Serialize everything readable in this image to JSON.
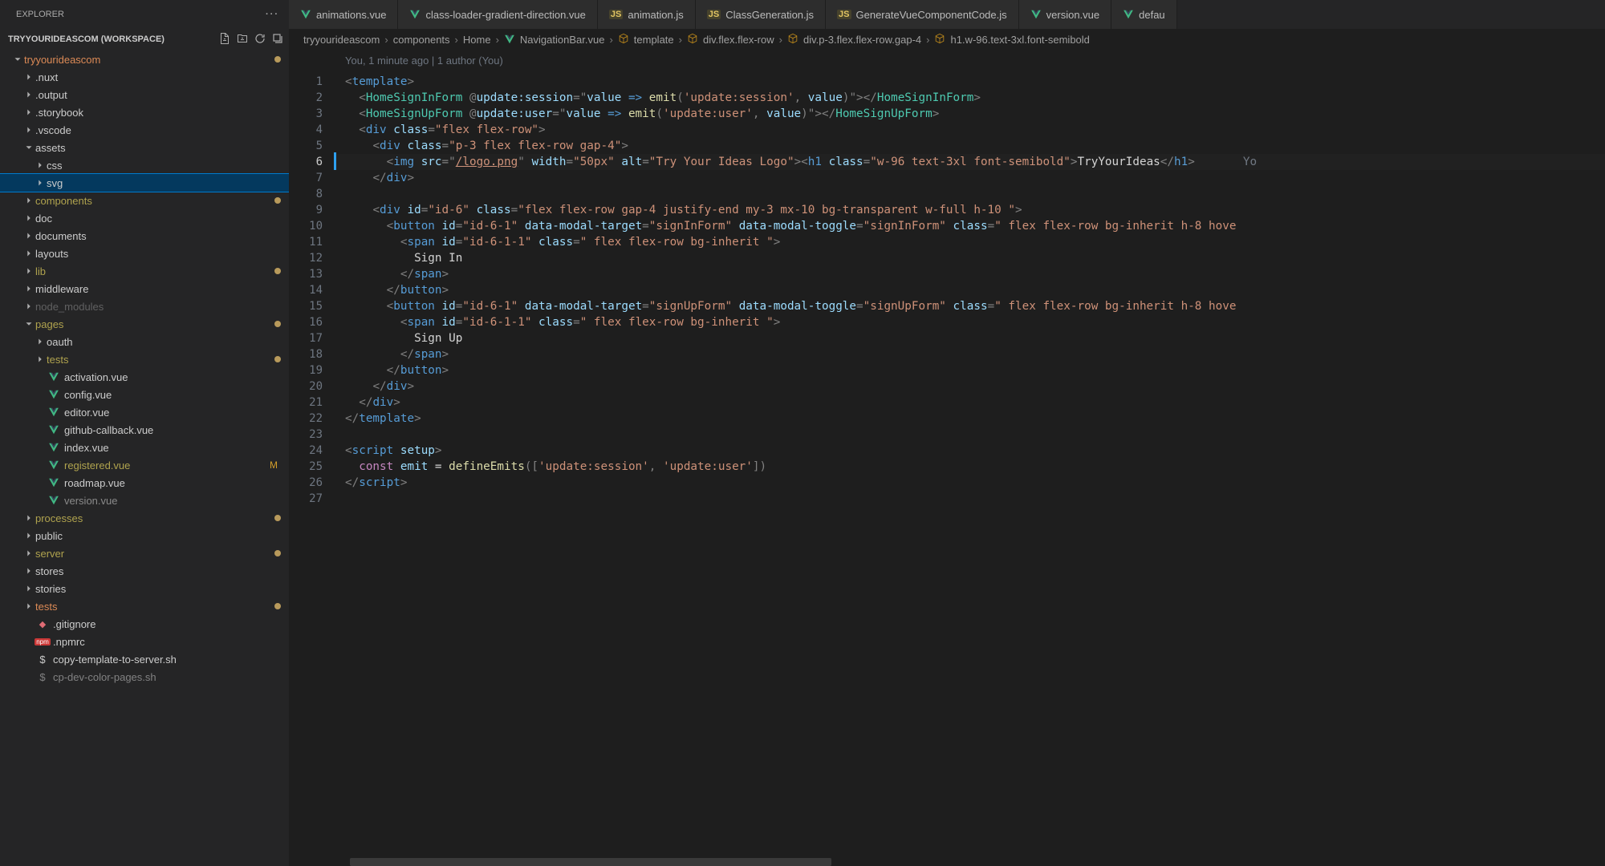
{
  "sidebar": {
    "title": "EXPLORER",
    "workspace": "TRYYOURIDEASCOM (WORKSPACE)",
    "tree": [
      {
        "label": "tryyourideascom",
        "depth": 0,
        "open": true,
        "folder": true,
        "color": "orange",
        "dot": true
      },
      {
        "label": ".nuxt",
        "depth": 1,
        "open": false,
        "folder": true,
        "color": "default"
      },
      {
        "label": ".output",
        "depth": 1,
        "open": false,
        "folder": true,
        "color": "default"
      },
      {
        "label": ".storybook",
        "depth": 1,
        "open": false,
        "folder": true,
        "color": "default"
      },
      {
        "label": ".vscode",
        "depth": 1,
        "open": false,
        "folder": true,
        "color": "default"
      },
      {
        "label": "assets",
        "depth": 1,
        "open": true,
        "folder": true,
        "color": "default"
      },
      {
        "label": "css",
        "depth": 2,
        "open": false,
        "folder": true,
        "color": "default"
      },
      {
        "label": "svg",
        "depth": 2,
        "open": false,
        "folder": true,
        "color": "default",
        "selected": true
      },
      {
        "label": "components",
        "depth": 1,
        "open": false,
        "folder": true,
        "color": "olive",
        "dot": true
      },
      {
        "label": "doc",
        "depth": 1,
        "open": false,
        "folder": true,
        "color": "default"
      },
      {
        "label": "documents",
        "depth": 1,
        "open": false,
        "folder": true,
        "color": "default"
      },
      {
        "label": "layouts",
        "depth": 1,
        "open": false,
        "folder": true,
        "color": "default"
      },
      {
        "label": "lib",
        "depth": 1,
        "open": false,
        "folder": true,
        "color": "olive",
        "dot": true
      },
      {
        "label": "middleware",
        "depth": 1,
        "open": false,
        "folder": true,
        "color": "default"
      },
      {
        "label": "node_modules",
        "depth": 1,
        "open": false,
        "folder": true,
        "color": "faded"
      },
      {
        "label": "pages",
        "depth": 1,
        "open": true,
        "folder": true,
        "color": "olive",
        "dot": true
      },
      {
        "label": "oauth",
        "depth": 2,
        "open": false,
        "folder": true,
        "color": "default"
      },
      {
        "label": "tests",
        "depth": 2,
        "open": false,
        "folder": true,
        "color": "olive",
        "dot": true
      },
      {
        "label": "activation.vue",
        "depth": 2,
        "folder": false,
        "icon": "vue",
        "color": "default"
      },
      {
        "label": "config.vue",
        "depth": 2,
        "folder": false,
        "icon": "vue",
        "color": "default"
      },
      {
        "label": "editor.vue",
        "depth": 2,
        "folder": false,
        "icon": "vue",
        "color": "default"
      },
      {
        "label": "github-callback.vue",
        "depth": 2,
        "folder": false,
        "icon": "vue",
        "color": "default"
      },
      {
        "label": "index.vue",
        "depth": 2,
        "folder": false,
        "icon": "vue",
        "color": "default"
      },
      {
        "label": "registered.vue",
        "depth": 2,
        "folder": false,
        "icon": "vue",
        "color": "olive",
        "m": "M"
      },
      {
        "label": "roadmap.vue",
        "depth": 2,
        "folder": false,
        "icon": "vue",
        "color": "default"
      },
      {
        "label": "version.vue",
        "depth": 2,
        "folder": false,
        "icon": "vue",
        "color": "dim"
      },
      {
        "label": "processes",
        "depth": 1,
        "open": false,
        "folder": true,
        "color": "olive",
        "dot": true
      },
      {
        "label": "public",
        "depth": 1,
        "open": false,
        "folder": true,
        "color": "default"
      },
      {
        "label": "server",
        "depth": 1,
        "open": false,
        "folder": true,
        "color": "olive",
        "dot": true
      },
      {
        "label": "stores",
        "depth": 1,
        "open": false,
        "folder": true,
        "color": "default"
      },
      {
        "label": "stories",
        "depth": 1,
        "open": false,
        "folder": true,
        "color": "default"
      },
      {
        "label": "tests",
        "depth": 1,
        "open": false,
        "folder": true,
        "color": "orange",
        "dot": true
      },
      {
        "label": ".gitignore",
        "depth": 1,
        "folder": false,
        "icon": "git",
        "color": "default"
      },
      {
        "label": ".npmrc",
        "depth": 1,
        "folder": false,
        "icon": "npm",
        "color": "default"
      },
      {
        "label": "copy-template-to-server.sh",
        "depth": 1,
        "folder": false,
        "icon": "sh",
        "color": "default"
      },
      {
        "label": "cp-dev-color-pages.sh",
        "depth": 1,
        "folder": false,
        "icon": "sh",
        "color": "default",
        "cut": true
      }
    ]
  },
  "tabs": [
    {
      "label": "animations.vue",
      "icon": "vue"
    },
    {
      "label": "class-loader-gradient-direction.vue",
      "icon": "vue"
    },
    {
      "label": "animation.js",
      "icon": "js"
    },
    {
      "label": "ClassGeneration.js",
      "icon": "js"
    },
    {
      "label": "GenerateVueComponentCode.js",
      "icon": "js"
    },
    {
      "label": "version.vue",
      "icon": "vue"
    },
    {
      "label": "defau",
      "icon": "vue",
      "cut": true
    }
  ],
  "breadcrumb": [
    {
      "label": "tryyourideascom"
    },
    {
      "label": "components"
    },
    {
      "label": "Home"
    },
    {
      "label": "NavigationBar.vue",
      "icon": "vue"
    },
    {
      "label": "template",
      "icon": "cube"
    },
    {
      "label": "div.flex.flex-row",
      "icon": "cube"
    },
    {
      "label": "div.p-3.flex.flex-row.gap-4",
      "icon": "cube"
    },
    {
      "label": "h1.w-96.text-3xl.font-semibold",
      "icon": "cube"
    }
  ],
  "blame": "You, 1 minute ago | 1 author (You)",
  "inline_blame": "Yo",
  "active_line": 6,
  "line_count": 27,
  "code_tokens": [
    [
      [
        "<",
        "punc"
      ],
      [
        "template",
        "tag"
      ],
      [
        ">",
        "punc"
      ]
    ],
    [
      [
        "  ",
        "plain"
      ],
      [
        "<",
        "punc"
      ],
      [
        "HomeSignInForm",
        "comp"
      ],
      [
        " @",
        "punc"
      ],
      [
        "update:session",
        "attr"
      ],
      [
        "=",
        "punc"
      ],
      [
        "\"",
        "punc"
      ],
      [
        "value",
        "var"
      ],
      [
        " ",
        "plain"
      ],
      [
        "=>",
        "arrow"
      ],
      [
        " ",
        "plain"
      ],
      [
        "emit",
        "fn"
      ],
      [
        "(",
        "punc"
      ],
      [
        "'update:session'",
        "str"
      ],
      [
        ", ",
        "punc"
      ],
      [
        "value",
        "var"
      ],
      [
        ")",
        "punc"
      ],
      [
        "\"",
        "punc"
      ],
      [
        "></",
        "punc"
      ],
      [
        "HomeSignInForm",
        "comp"
      ],
      [
        ">",
        "punc"
      ]
    ],
    [
      [
        "  ",
        "plain"
      ],
      [
        "<",
        "punc"
      ],
      [
        "HomeSignUpForm",
        "comp"
      ],
      [
        " @",
        "punc"
      ],
      [
        "update:user",
        "attr"
      ],
      [
        "=",
        "punc"
      ],
      [
        "\"",
        "punc"
      ],
      [
        "value",
        "var"
      ],
      [
        " ",
        "plain"
      ],
      [
        "=>",
        "arrow"
      ],
      [
        " ",
        "plain"
      ],
      [
        "emit",
        "fn"
      ],
      [
        "(",
        "punc"
      ],
      [
        "'update:user'",
        "str"
      ],
      [
        ", ",
        "punc"
      ],
      [
        "value",
        "var"
      ],
      [
        ")",
        "punc"
      ],
      [
        "\"",
        "punc"
      ],
      [
        "></",
        "punc"
      ],
      [
        "HomeSignUpForm",
        "comp"
      ],
      [
        ">",
        "punc"
      ]
    ],
    [
      [
        "  ",
        "plain"
      ],
      [
        "<",
        "punc"
      ],
      [
        "div",
        "tag"
      ],
      [
        " ",
        "plain"
      ],
      [
        "class",
        "attr"
      ],
      [
        "=",
        "punc"
      ],
      [
        "\"flex flex-row\"",
        "str"
      ],
      [
        ">",
        "punc"
      ]
    ],
    [
      [
        "    ",
        "plain"
      ],
      [
        "<",
        "punc"
      ],
      [
        "div",
        "tag"
      ],
      [
        " ",
        "plain"
      ],
      [
        "class",
        "attr"
      ],
      [
        "=",
        "punc"
      ],
      [
        "\"p-3 flex flex-row gap-4\"",
        "str"
      ],
      [
        ">",
        "punc"
      ]
    ],
    [
      [
        "      ",
        "plain"
      ],
      [
        "<",
        "punc"
      ],
      [
        "img",
        "tag"
      ],
      [
        " ",
        "plain"
      ],
      [
        "src",
        "attr"
      ],
      [
        "=",
        "punc"
      ],
      [
        "\"",
        "punc"
      ],
      [
        "/logo.png",
        "link"
      ],
      [
        "\"",
        "punc"
      ],
      [
        " ",
        "plain"
      ],
      [
        "width",
        "attr"
      ],
      [
        "=",
        "punc"
      ],
      [
        "\"50px\"",
        "str"
      ],
      [
        " ",
        "plain"
      ],
      [
        "alt",
        "attr"
      ],
      [
        "=",
        "punc"
      ],
      [
        "\"Try Your Ideas Logo\"",
        "str"
      ],
      [
        "><",
        "punc"
      ],
      [
        "h1",
        "tag"
      ],
      [
        " ",
        "plain"
      ],
      [
        "class",
        "attr"
      ],
      [
        "=",
        "punc"
      ],
      [
        "\"w-96 text-3xl font-semibold\"",
        "str"
      ],
      [
        ">",
        "punc"
      ],
      [
        "TryYourIdeas",
        "plain"
      ],
      [
        "</",
        "punc"
      ],
      [
        "h1",
        "tag"
      ],
      [
        ">",
        "punc"
      ]
    ],
    [
      [
        "    ",
        "plain"
      ],
      [
        "</",
        "punc"
      ],
      [
        "div",
        "tag"
      ],
      [
        ">",
        "punc"
      ]
    ],
    [],
    [
      [
        "    ",
        "plain"
      ],
      [
        "<",
        "punc"
      ],
      [
        "div",
        "tag"
      ],
      [
        " ",
        "plain"
      ],
      [
        "id",
        "attr"
      ],
      [
        "=",
        "punc"
      ],
      [
        "\"id-6\"",
        "str"
      ],
      [
        " ",
        "plain"
      ],
      [
        "class",
        "attr"
      ],
      [
        "=",
        "punc"
      ],
      [
        "\"flex flex-row gap-4 justify-end my-3 mx-10 bg-transparent w-full h-10 \"",
        "str"
      ],
      [
        ">",
        "punc"
      ]
    ],
    [
      [
        "      ",
        "plain"
      ],
      [
        "<",
        "punc"
      ],
      [
        "button",
        "tag"
      ],
      [
        " ",
        "plain"
      ],
      [
        "id",
        "attr"
      ],
      [
        "=",
        "punc"
      ],
      [
        "\"id-6-1\"",
        "str"
      ],
      [
        " ",
        "plain"
      ],
      [
        "data-modal-target",
        "attr"
      ],
      [
        "=",
        "punc"
      ],
      [
        "\"signInForm\"",
        "str"
      ],
      [
        " ",
        "plain"
      ],
      [
        "data-modal-toggle",
        "attr"
      ],
      [
        "=",
        "punc"
      ],
      [
        "\"signInForm\"",
        "str"
      ],
      [
        " ",
        "plain"
      ],
      [
        "class",
        "attr"
      ],
      [
        "=",
        "punc"
      ],
      [
        "\" flex flex-row bg-inherit h-8 hove",
        "str"
      ]
    ],
    [
      [
        "        ",
        "plain"
      ],
      [
        "<",
        "punc"
      ],
      [
        "span",
        "tag"
      ],
      [
        " ",
        "plain"
      ],
      [
        "id",
        "attr"
      ],
      [
        "=",
        "punc"
      ],
      [
        "\"id-6-1-1\"",
        "str"
      ],
      [
        " ",
        "plain"
      ],
      [
        "class",
        "attr"
      ],
      [
        "=",
        "punc"
      ],
      [
        "\" flex flex-row bg-inherit \"",
        "str"
      ],
      [
        ">",
        "punc"
      ]
    ],
    [
      [
        "          ",
        "plain"
      ],
      [
        "Sign In",
        "plain"
      ]
    ],
    [
      [
        "        ",
        "plain"
      ],
      [
        "</",
        "punc"
      ],
      [
        "span",
        "tag"
      ],
      [
        ">",
        "punc"
      ]
    ],
    [
      [
        "      ",
        "plain"
      ],
      [
        "</",
        "punc"
      ],
      [
        "button",
        "tag"
      ],
      [
        ">",
        "punc"
      ]
    ],
    [
      [
        "      ",
        "plain"
      ],
      [
        "<",
        "punc"
      ],
      [
        "button",
        "tag"
      ],
      [
        " ",
        "plain"
      ],
      [
        "id",
        "attr"
      ],
      [
        "=",
        "punc"
      ],
      [
        "\"id-6-1\"",
        "str"
      ],
      [
        " ",
        "plain"
      ],
      [
        "data-modal-target",
        "attr"
      ],
      [
        "=",
        "punc"
      ],
      [
        "\"signUpForm\"",
        "str"
      ],
      [
        " ",
        "plain"
      ],
      [
        "data-modal-toggle",
        "attr"
      ],
      [
        "=",
        "punc"
      ],
      [
        "\"signUpForm\"",
        "str"
      ],
      [
        " ",
        "plain"
      ],
      [
        "class",
        "attr"
      ],
      [
        "=",
        "punc"
      ],
      [
        "\" flex flex-row bg-inherit h-8 hove",
        "str"
      ]
    ],
    [
      [
        "        ",
        "plain"
      ],
      [
        "<",
        "punc"
      ],
      [
        "span",
        "tag"
      ],
      [
        " ",
        "plain"
      ],
      [
        "id",
        "attr"
      ],
      [
        "=",
        "punc"
      ],
      [
        "\"id-6-1-1\"",
        "str"
      ],
      [
        " ",
        "plain"
      ],
      [
        "class",
        "attr"
      ],
      [
        "=",
        "punc"
      ],
      [
        "\" flex flex-row bg-inherit \"",
        "str"
      ],
      [
        ">",
        "punc"
      ]
    ],
    [
      [
        "          ",
        "plain"
      ],
      [
        "Sign Up",
        "plain"
      ]
    ],
    [
      [
        "        ",
        "plain"
      ],
      [
        "</",
        "punc"
      ],
      [
        "span",
        "tag"
      ],
      [
        ">",
        "punc"
      ]
    ],
    [
      [
        "      ",
        "plain"
      ],
      [
        "</",
        "punc"
      ],
      [
        "button",
        "tag"
      ],
      [
        ">",
        "punc"
      ]
    ],
    [
      [
        "    ",
        "plain"
      ],
      [
        "</",
        "punc"
      ],
      [
        "div",
        "tag"
      ],
      [
        ">",
        "punc"
      ]
    ],
    [
      [
        "  ",
        "plain"
      ],
      [
        "</",
        "punc"
      ],
      [
        "div",
        "tag"
      ],
      [
        ">",
        "punc"
      ]
    ],
    [
      [
        "</",
        "punc"
      ],
      [
        "template",
        "tag"
      ],
      [
        ">",
        "punc"
      ]
    ],
    [],
    [
      [
        "<",
        "punc"
      ],
      [
        "script",
        "tag"
      ],
      [
        " ",
        "plain"
      ],
      [
        "setup",
        "attr"
      ],
      [
        ">",
        "punc"
      ]
    ],
    [
      [
        "  ",
        "plain"
      ],
      [
        "const",
        "kw"
      ],
      [
        " ",
        "plain"
      ],
      [
        "emit",
        "var"
      ],
      [
        " = ",
        "plain"
      ],
      [
        "defineEmits",
        "fn"
      ],
      [
        "([",
        "punc"
      ],
      [
        "'update:session'",
        "str"
      ],
      [
        ", ",
        "punc"
      ],
      [
        "'update:user'",
        "str"
      ],
      [
        "])",
        "punc"
      ]
    ],
    [
      [
        "</",
        "punc"
      ],
      [
        "script",
        "tag"
      ],
      [
        ">",
        "punc"
      ]
    ],
    []
  ]
}
